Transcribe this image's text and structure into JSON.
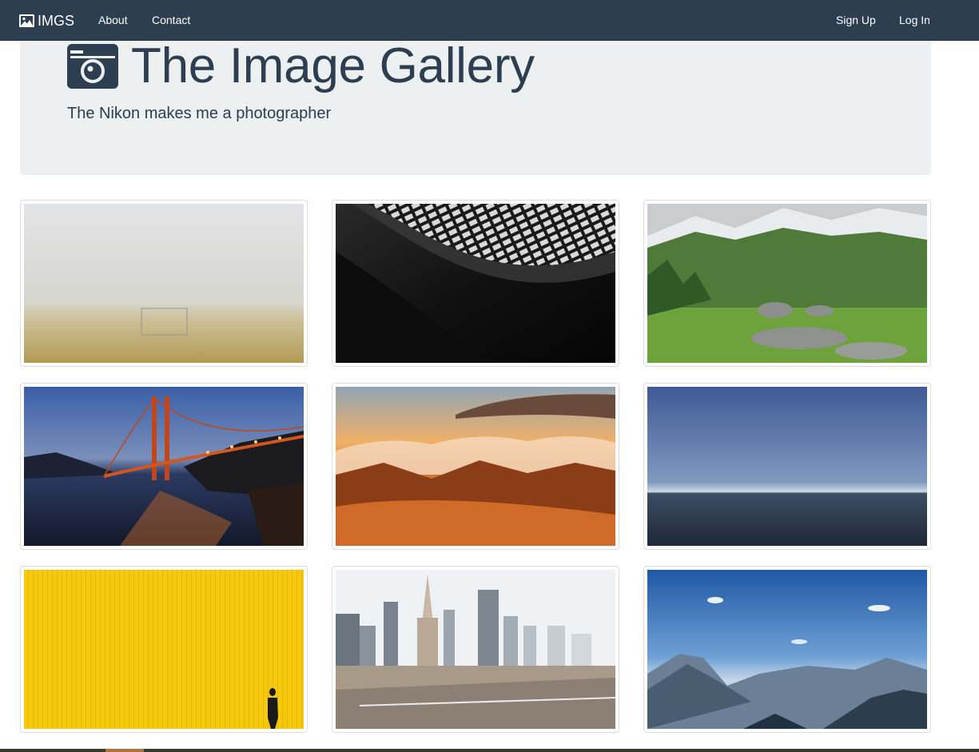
{
  "navbar": {
    "brand": "IMGS",
    "brand_icon": "image-icon",
    "links": {
      "about": "About",
      "contact": "Contact",
      "signup": "Sign Up",
      "login": "Log In"
    }
  },
  "jumbotron": {
    "icon": "camera-icon",
    "title": "The Image Gallery",
    "subtitle": "The Nikon makes me a photographer"
  },
  "gallery": {
    "items": [
      {
        "subject": "foggy-field-goal"
      },
      {
        "subject": "black-white-architecture"
      },
      {
        "subject": "green-mountain-valley"
      },
      {
        "subject": "golden-gate-bridge-night"
      },
      {
        "subject": "sunset-clouds-mountains"
      },
      {
        "subject": "blue-sea-horizon"
      },
      {
        "subject": "yellow-wall-person"
      },
      {
        "subject": "san-francisco-skyline"
      },
      {
        "subject": "blue-sky-mountain-range"
      }
    ]
  },
  "colors": {
    "navbar_bg": "#2c3e50",
    "jumbotron_bg": "#ecf0f1",
    "text": "#2c3e50"
  }
}
